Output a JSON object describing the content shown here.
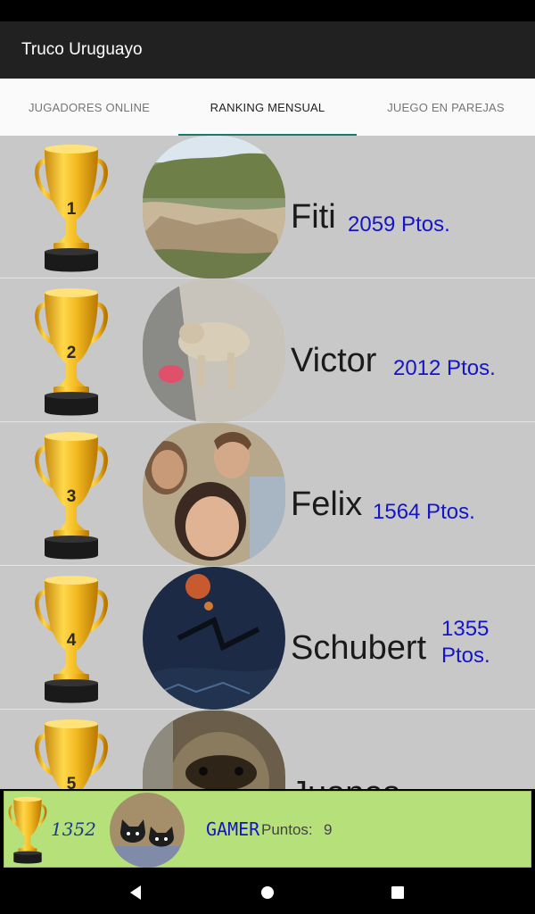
{
  "app": {
    "title": "Truco Uruguayo"
  },
  "tabs": [
    {
      "label": "JUGADORES ONLINE",
      "active": false
    },
    {
      "label": "RANKING MENSUAL",
      "active": true
    },
    {
      "label": "JUEGO EN PAREJAS",
      "active": false
    }
  ],
  "ranking": [
    {
      "rank": "1",
      "name": "Fiti",
      "points": "2059 Ptos.",
      "avatar": "landscape-photo"
    },
    {
      "rank": "2",
      "name": "Victor",
      "points": "2012 Ptos.",
      "avatar": "dog-photo"
    },
    {
      "rank": "3",
      "name": "Felix",
      "points": "1564 Ptos.",
      "avatar": "family-selfie-photo"
    },
    {
      "rank": "4",
      "name": "Schubert",
      "points_line1": "1355",
      "points_line2": "Ptos.",
      "avatar": "night-moon-photo"
    },
    {
      "rank": "5",
      "name": "Juanes",
      "avatar": "sloth-photo"
    }
  ],
  "me": {
    "points": "1352",
    "name": "GAMER",
    "score_label": "Puntos:",
    "score": "9",
    "avatar": "cats-cartoon"
  },
  "colors": {
    "appbar": "#212121",
    "tab_indicator": "#1b7a6e",
    "list_bg": "#c8c8c8",
    "points_blue": "#1414c8",
    "my_bar": "#b5e07a"
  }
}
